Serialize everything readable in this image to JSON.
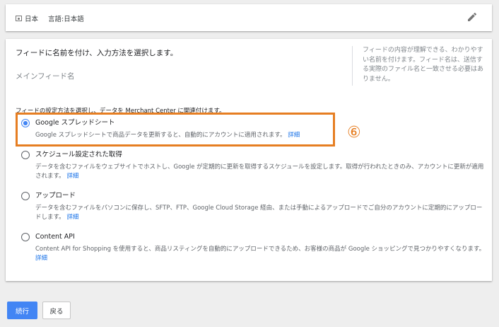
{
  "top_bar": {
    "country_value": "日本",
    "language_label": "言語: ",
    "language_value": "日本語"
  },
  "main": {
    "title": "フィードに名前を付け、入力方法を選択します。",
    "name_input": {
      "placeholder": "メインフィード名",
      "value": ""
    },
    "side_note": "フィードの内容が理解できる、わかりやすい名前を付けます。フィード名は、送信する実際のファイル名と一致させる必要はありません。",
    "method_heading": "フィードの設定方法を選択し、データを Merchant Center に関連付けます。",
    "options": [
      {
        "title": "Google スプレッドシート",
        "description": "Google スプレッドシートで商品データを更新すると、自動的にアカウントに適用されます。",
        "link": "詳細",
        "selected": true
      },
      {
        "title": "スケジュール設定された取得",
        "description": "データを含むファイルをウェブサイトでホストし、Google が定期的に更新を取得するスケジュールを設定します。取得が行われたときのみ、アカウントに更新が適用されます。",
        "link": "詳細",
        "selected": false
      },
      {
        "title": "アップロード",
        "description": "データを含むファイルをパソコンに保存し、SFTP、FTP、Google Cloud Storage 経由、または手動によるアップロードでご自分のアカウントに定期的にアップロードします。",
        "link": "詳細",
        "selected": false
      },
      {
        "title": "Content API",
        "description": "Content API for Shopping を使用すると、商品リスティングを自動的にアップロードできるため、お客様の商品が Google ショッピングで見つかりやすくなります。",
        "link": "詳細",
        "selected": false
      }
    ]
  },
  "annotation": {
    "step_number": "⑥",
    "color": "#e67e22"
  },
  "buttons": {
    "continue_label": "続行",
    "back_label": "戻る"
  },
  "colors": {
    "accent": "#4285f4",
    "link": "#1a73e8",
    "background": "#eeeeee"
  }
}
